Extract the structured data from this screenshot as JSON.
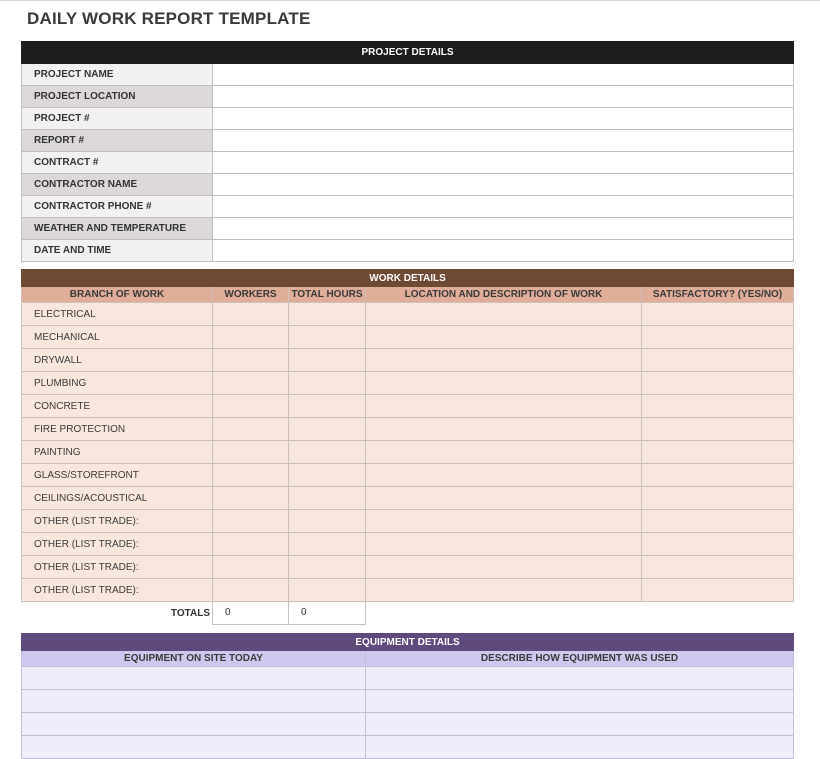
{
  "title": "DAILY WORK REPORT TEMPLATE",
  "project_details": {
    "header": "PROJECT DETAILS",
    "fields": [
      {
        "label": "PROJECT NAME",
        "value": ""
      },
      {
        "label": "PROJECT LOCATION",
        "value": ""
      },
      {
        "label": "PROJECT #",
        "value": ""
      },
      {
        "label": "REPORT #",
        "value": ""
      },
      {
        "label": "CONTRACT #",
        "value": ""
      },
      {
        "label": "CONTRACTOR NAME",
        "value": ""
      },
      {
        "label": "CONTRACTOR PHONE #",
        "value": ""
      },
      {
        "label": "WEATHER AND TEMPERATURE",
        "value": ""
      },
      {
        "label": "DATE AND TIME",
        "value": ""
      }
    ]
  },
  "work_details": {
    "header": "WORK DETAILS",
    "columns": [
      "BRANCH OF WORK",
      "WORKERS",
      "TOTAL HOURS",
      "LOCATION AND DESCRIPTION OF WORK",
      "SATISFACTORY? (YES/NO)"
    ],
    "rows": [
      {
        "branch": "ELECTRICAL",
        "workers": "",
        "hours": "",
        "description": "",
        "satisfactory": ""
      },
      {
        "branch": "MECHANICAL",
        "workers": "",
        "hours": "",
        "description": "",
        "satisfactory": ""
      },
      {
        "branch": "DRYWALL",
        "workers": "",
        "hours": "",
        "description": "",
        "satisfactory": ""
      },
      {
        "branch": "PLUMBING",
        "workers": "",
        "hours": "",
        "description": "",
        "satisfactory": ""
      },
      {
        "branch": "CONCRETE",
        "workers": "",
        "hours": "",
        "description": "",
        "satisfactory": ""
      },
      {
        "branch": "FIRE PROTECTION",
        "workers": "",
        "hours": "",
        "description": "",
        "satisfactory": ""
      },
      {
        "branch": "PAINTING",
        "workers": "",
        "hours": "",
        "description": "",
        "satisfactory": ""
      },
      {
        "branch": "GLASS/STOREFRONT",
        "workers": "",
        "hours": "",
        "description": "",
        "satisfactory": ""
      },
      {
        "branch": "CEILINGS/ACOUSTICAL",
        "workers": "",
        "hours": "",
        "description": "",
        "satisfactory": ""
      },
      {
        "branch": "OTHER (LIST TRADE):",
        "workers": "",
        "hours": "",
        "description": "",
        "satisfactory": ""
      },
      {
        "branch": "OTHER (LIST TRADE):",
        "workers": "",
        "hours": "",
        "description": "",
        "satisfactory": ""
      },
      {
        "branch": "OTHER (LIST TRADE):",
        "workers": "",
        "hours": "",
        "description": "",
        "satisfactory": ""
      },
      {
        "branch": "OTHER (LIST TRADE):",
        "workers": "",
        "hours": "",
        "description": "",
        "satisfactory": ""
      }
    ],
    "totals": {
      "label": "TOTALS",
      "workers": "0",
      "hours": "0"
    }
  },
  "equipment_details": {
    "header": "EQUIPMENT DETAILS",
    "columns": [
      "EQUIPMENT ON SITE TODAY",
      "DESCRIBE HOW EQUIPMENT WAS USED"
    ],
    "rows": [
      {
        "equipment": "",
        "usage": ""
      },
      {
        "equipment": "",
        "usage": ""
      },
      {
        "equipment": "",
        "usage": ""
      },
      {
        "equipment": "",
        "usage": ""
      }
    ]
  },
  "colors": {
    "project_bar": "#1d1d1d",
    "work_bar": "#6e4934",
    "work_header": "#dfad98",
    "work_cell": "#f8e7dc",
    "equipment_bar": "#5e4a7d",
    "equipment_header": "#cec7ee",
    "equipment_cell": "#efedfa"
  }
}
